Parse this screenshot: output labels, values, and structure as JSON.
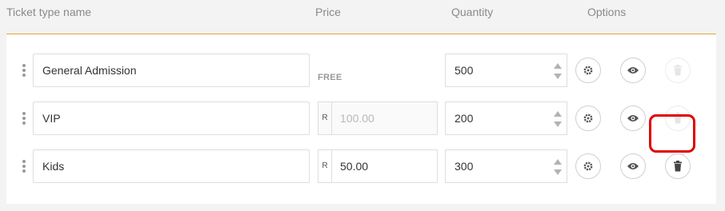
{
  "header": {
    "name": "Ticket type name",
    "price": "Price",
    "quantity": "Quantity",
    "options": "Options"
  },
  "tickets": [
    {
      "name": "General Admission",
      "price_label": "FREE",
      "quantity": "500"
    },
    {
      "name": "VIP",
      "currency": "R",
      "price": "100.00",
      "quantity": "200"
    },
    {
      "name": "Kids",
      "currency": "R",
      "price": "50.00",
      "quantity": "300"
    }
  ],
  "icons": {
    "drag": "drag-handle-icon",
    "settings": "gear-icon",
    "visibility": "eye-icon",
    "delete": "trash-icon"
  },
  "colors": {
    "accent": "#e8a33c",
    "highlight": "#e00000"
  }
}
